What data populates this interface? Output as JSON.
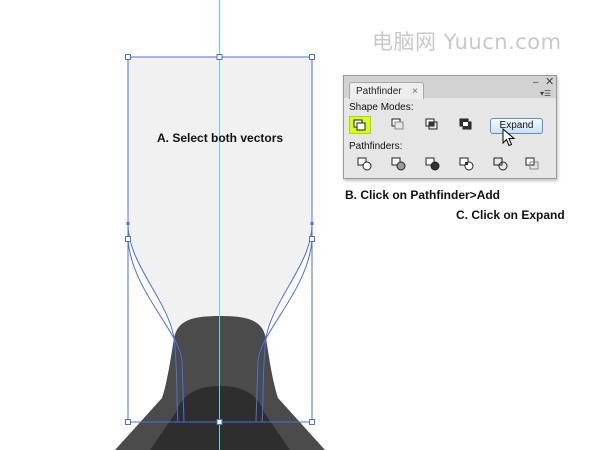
{
  "watermark": "电脑网 Yuucn.com",
  "annotations": {
    "a": "A. Select both vectors",
    "b": "B. Click on Pathfinder>Add",
    "c": "C. Click on Expand"
  },
  "panel": {
    "tab_label": "Pathfinder",
    "tab_close": "×",
    "minimize": "–",
    "close": "✕",
    "menu": "▾☰",
    "shape_modes_label": "Shape Modes:",
    "pathfinders_label": "Pathfinders:",
    "expand_label": "Expand",
    "shape_mode_tools": [
      "unite-icon",
      "minus-front-icon",
      "intersect-icon",
      "exclude-icon"
    ],
    "pathfinder_tools": [
      "divide-icon",
      "trim-icon",
      "merge-icon",
      "crop-icon",
      "outline-icon",
      "minus-back-icon"
    ]
  },
  "colors": {
    "accent_highlight": "#d4ff1e",
    "selection_blue": "#4a6fe0",
    "guide_cyan": "#57d8d8",
    "shape_dark": "#4b4b4b",
    "shape_darker": "#2e2e2e",
    "shape_light": "#f1f1f1"
  }
}
